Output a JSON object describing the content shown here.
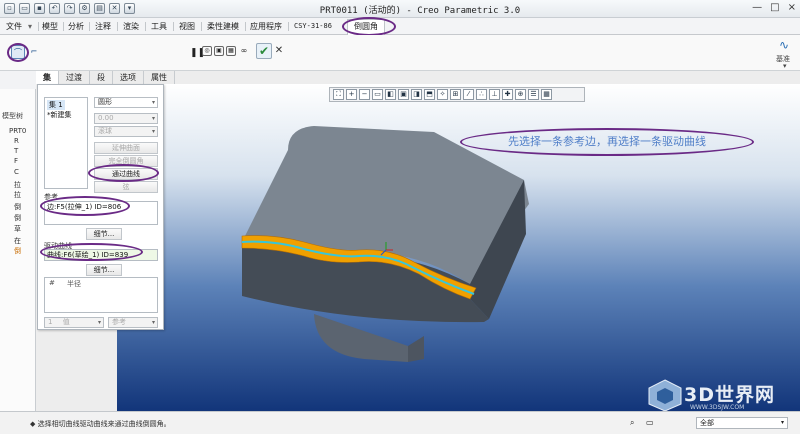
{
  "window": {
    "title": "PRT0011 (活动的) - Creo Parametric 3.0",
    "controls": [
      "—",
      "□",
      "×"
    ]
  },
  "menu": {
    "items": [
      "文件",
      "模型",
      "分析",
      "注释",
      "渲染",
      "工具",
      "视图",
      "柔性建模",
      "应用程序",
      "CSY-31-86",
      "倒圆角"
    ]
  },
  "ribbon": {
    "right_label": "基准"
  },
  "model_tree": {
    "header": "模型树",
    "rows": [
      "PRT0",
      "R",
      "T",
      "F",
      "C",
      "拉",
      "拉",
      "倒",
      "倒",
      "草",
      "在",
      "倒"
    ]
  },
  "dashboard": {
    "tabs": [
      "集",
      "过渡",
      "段",
      "选项",
      "属性"
    ],
    "set_items": [
      "集 1",
      "*新建集"
    ],
    "shape_select": "圆形",
    "radius_value": "0.00",
    "method_select": "滚球",
    "buttons": [
      "延伸曲面",
      "完全倒圆角",
      "通过曲线",
      "弦"
    ],
    "references_label": "参考",
    "reference_value": "边:F5(拉伸_1) ID=806",
    "details_button": "细节...",
    "driving_curve_label": "驱动曲线",
    "driving_curve_value": "曲线:F6(草绘_1) ID=839",
    "curve_details_button": "细节...",
    "table_headers": [
      "#",
      "半径"
    ],
    "bottom_select_left": "值",
    "bottom_select_left_num": "1",
    "bottom_select_right": "参考"
  },
  "annotation": "先选择一条参考边，再选择一条驱动曲线",
  "status": {
    "message": "◆ 选择相切曲线驱动曲线来通过曲线倒圆角。",
    "filter": "全部"
  },
  "watermark": {
    "brand": "3D世界网",
    "url": "WWW.3DSJW.COM"
  },
  "colors": {
    "fillet": "#f0a000",
    "curve": "#39c6d8",
    "highlight": "#6a2a86",
    "part": "#7d8692"
  }
}
